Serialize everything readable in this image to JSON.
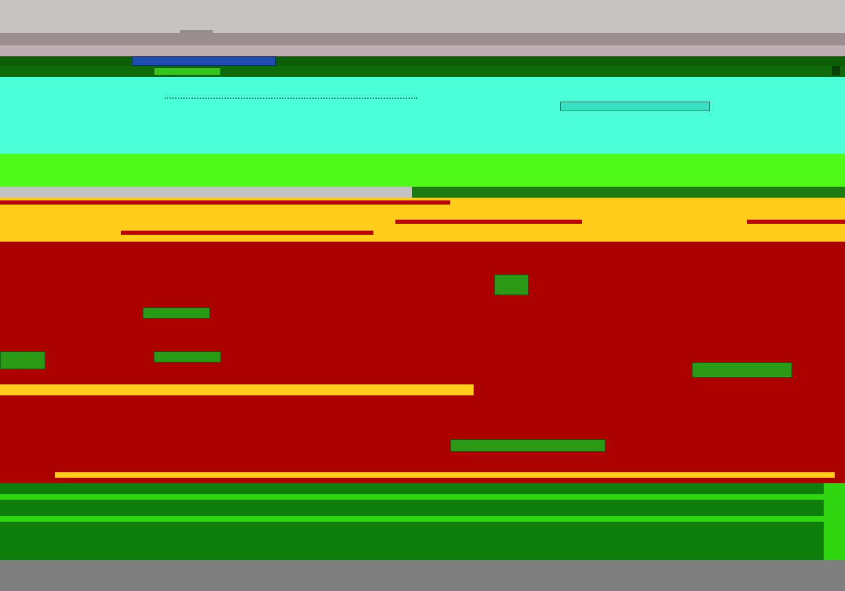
{
  "window": {
    "title": "",
    "menu": [],
    "status": ""
  },
  "toolbar": {
    "tabs": [],
    "search_placeholder": ""
  },
  "sections": [
    {
      "name": "header"
    },
    {
      "name": "info-panel"
    },
    {
      "name": "content"
    },
    {
      "name": "footer"
    }
  ],
  "colors": {
    "chrome": "#c7c3c1",
    "title_bar": "#9c8e90",
    "header": "#0b5d06",
    "cyan_panel": "#4bffd9",
    "green_panel": "#4ffb18",
    "accent_yellow": "#ffcd1a",
    "content_red": "#ad0000",
    "footer_green": "#0e7f0a",
    "status_gray": "#7e7e7e"
  },
  "icons": [
    "app-icon",
    "close-icon",
    "scroll-indicator-icon"
  ]
}
